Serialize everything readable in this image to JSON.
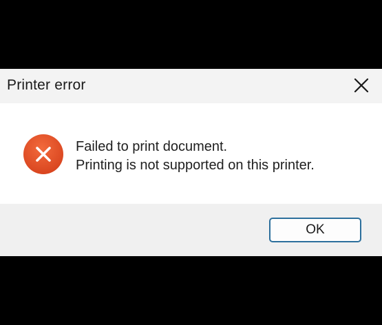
{
  "dialog": {
    "title": "Printer error",
    "close_icon": "close-icon",
    "status_icon": "error-x-circle-icon",
    "message_lines": [
      "Failed to print document.",
      "Printing is not supported on this printer."
    ],
    "ok_label": "OK"
  },
  "colors": {
    "error_icon": "#e5532a",
    "button_border": "#2c6f9c",
    "content_background": "#ffffff",
    "frame_background": "#f3f3f3"
  }
}
